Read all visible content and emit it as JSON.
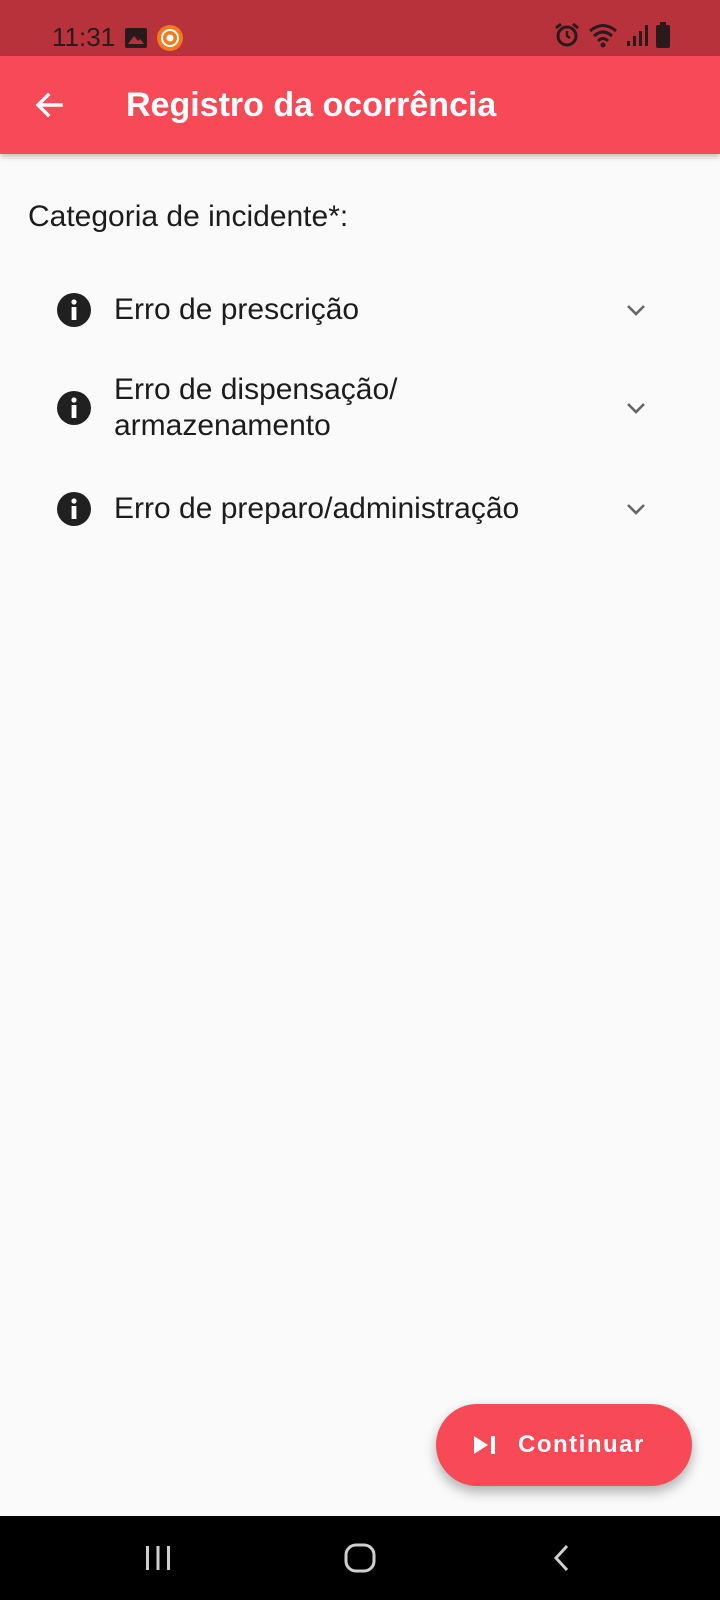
{
  "status_bar": {
    "time": "11:31",
    "left_icons": [
      "image-icon",
      "screen-record-icon"
    ],
    "right_icons": [
      "alarm-icon",
      "wifi-icon",
      "signal-icon",
      "battery-icon"
    ]
  },
  "app_bar": {
    "title": "Registro da ocorrência",
    "back_icon": "arrow-back-icon",
    "color": "#f84957"
  },
  "form": {
    "label": "Categoria de incidente*:",
    "categories": [
      {
        "label": "Erro de prescrição",
        "icon": "info-icon"
      },
      {
        "label": "Erro de dispensação/ armazenamento",
        "icon": "info-icon"
      },
      {
        "label": "Erro de preparo/administração",
        "icon": "info-icon"
      }
    ]
  },
  "fab": {
    "label": "Continuar",
    "icon": "skip-next-icon",
    "color": "#f84957"
  },
  "nav_bar": {
    "buttons": [
      "recent-apps-icon",
      "home-icon",
      "back-icon"
    ]
  }
}
